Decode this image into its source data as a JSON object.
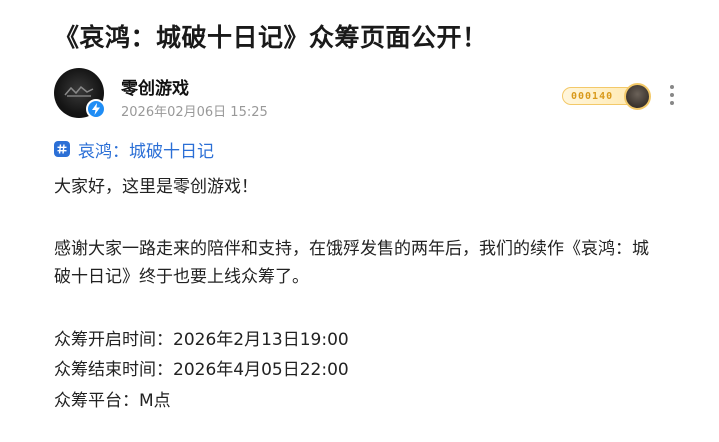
{
  "article": {
    "title": "《哀鸿：城破十日记》众筹页面公开！"
  },
  "author": {
    "name": "零创游戏",
    "post_time": "2026年02月06日 15:25",
    "level_text": "000140",
    "verify_color": "#1f8df5"
  },
  "topic": {
    "label": "哀鸿：城破十日记",
    "color": "#2b6fd6"
  },
  "content": {
    "greeting": "大家好，这里是零创游戏！",
    "intro_line1": "感谢大家一路走来的陪伴和支持，在饿殍发售的两年后，我们的续作《哀鸿：城",
    "intro_line2": "破十日记》终于也要上线众筹了。",
    "start_time": "众筹开启时间：2026年2月13日19:00",
    "end_time": "众筹结束时间：2026年4月05日22:00",
    "platform": "众筹平台：M点"
  },
  "icons": {
    "verify": "lightning-bolt-icon",
    "topic": "hashtag-icon",
    "more": "vertical-ellipsis-icon"
  }
}
